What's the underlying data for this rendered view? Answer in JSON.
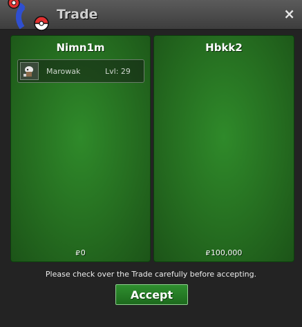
{
  "window": {
    "title": "Trade",
    "close_glyph": "×"
  },
  "left": {
    "player": "Nimn1m",
    "items": [
      {
        "name": "Marowak",
        "level": "Lvl: 29",
        "icon": "marowak-sprite-icon"
      }
    ],
    "currency_symbol": "₽",
    "money": "0"
  },
  "right": {
    "player": "Hbkk2",
    "items": [],
    "currency_symbol": "₽",
    "money": "100,000"
  },
  "notice": "Please check over the Trade carefully before accepting.",
  "accept_label": "Accept",
  "colors": {
    "panel_green": "#256d20",
    "accept_green": "#2f8f2f",
    "window_bg": "#232323"
  }
}
